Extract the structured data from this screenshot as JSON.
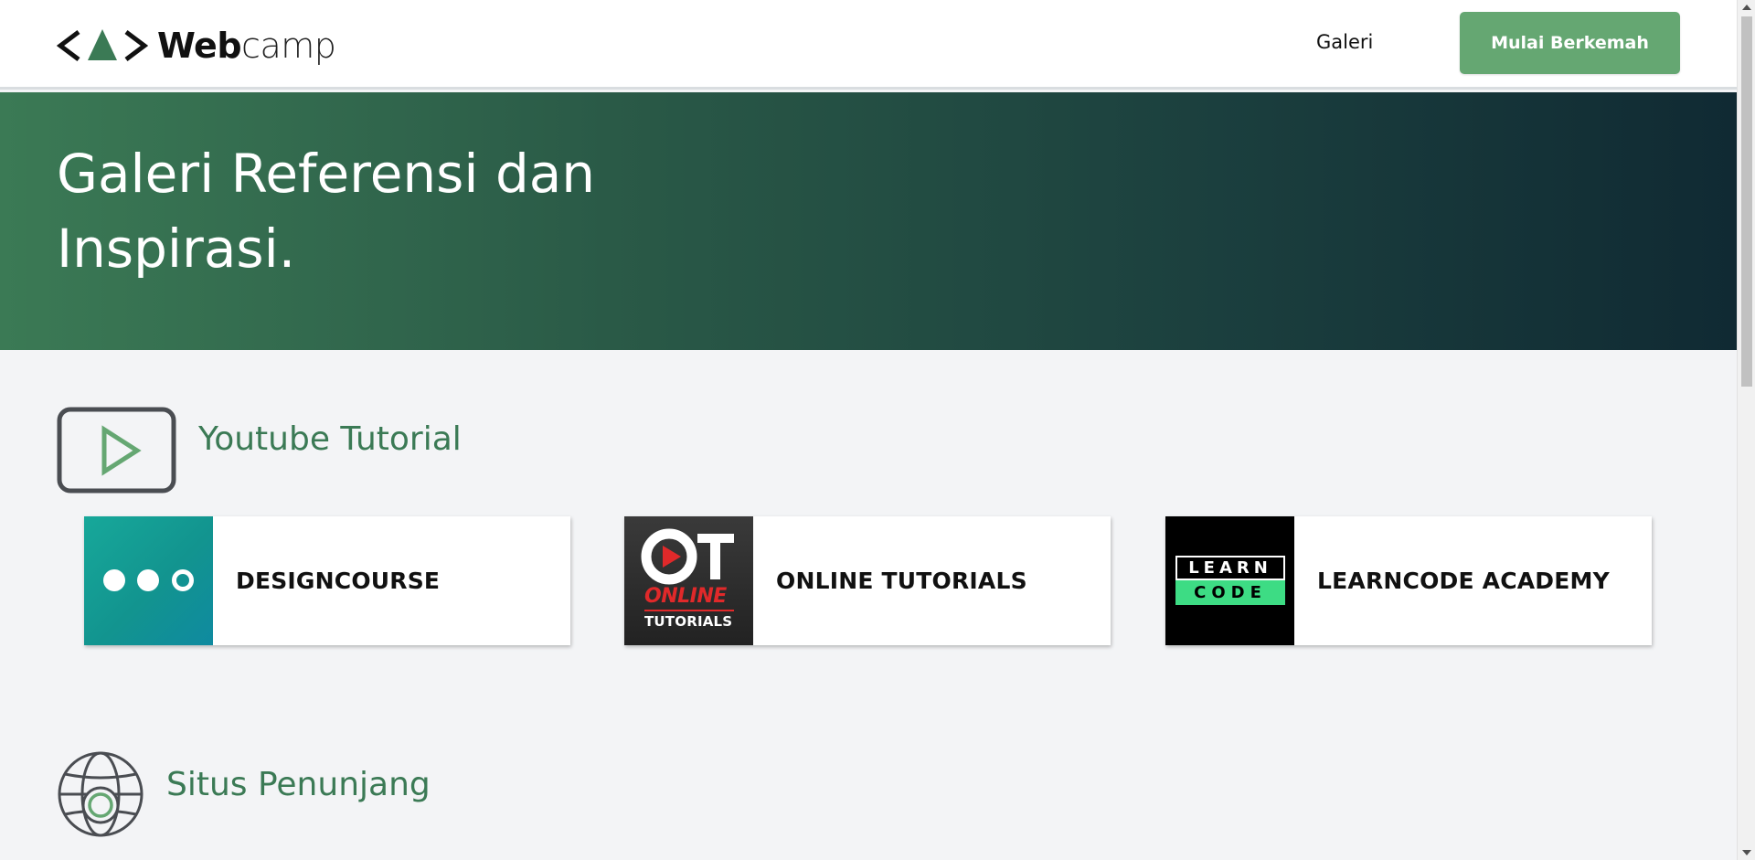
{
  "navbar": {
    "logo": {
      "brand_bold": "Web",
      "brand_light": "camp",
      "icon_left": "<",
      "icon_right": ">"
    },
    "links": [
      {
        "label": "Galeri"
      }
    ],
    "cta_label": "Mulai Berkemah"
  },
  "hero": {
    "title": "Galeri Referensi dan Inspirasi."
  },
  "sections": {
    "youtube": {
      "title": "Youtube Tutorial",
      "icon": "play-icon",
      "cards": [
        {
          "label": "DESIGNCOURSE",
          "thumb": "designcourse-logo"
        },
        {
          "label": "ONLINE TUTORIALS",
          "thumb": "online-tutorials-logo",
          "thumb_text": {
            "big": "OT",
            "middle": "ONLINE",
            "bottom": "TUTORIALS"
          }
        },
        {
          "label": "LEARNCODE ACADEMY",
          "thumb": "learncode-logo",
          "thumb_text": {
            "top": "LEARN",
            "bottom": "CODE"
          }
        }
      ]
    },
    "situs": {
      "title": "Situs Penunjang",
      "icon": "globe-icon"
    }
  },
  "colors": {
    "accent": "#65a772",
    "heading_green": "#3b7a55",
    "hero_start": "#3b7a55",
    "hero_end": "#102a33",
    "background": "#f3f4f6"
  }
}
